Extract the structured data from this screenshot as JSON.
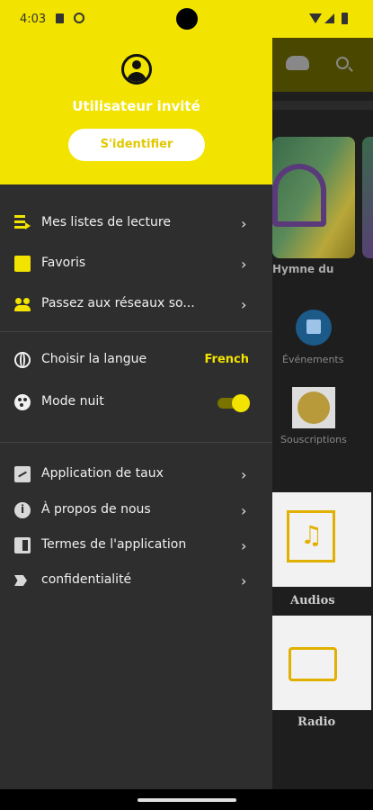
{
  "status_bar": {
    "time": "4:03",
    "icons": [
      "sim-card-icon",
      "download-icon",
      "wifi-icon",
      "signal-icon",
      "battery-icon"
    ]
  },
  "drawer": {
    "user_name": "Utilisateur invité",
    "login_label": "S'identifier",
    "section1": [
      {
        "icon": "playlist-icon",
        "label": "Mes listes de lecture"
      },
      {
        "icon": "favorites-icon",
        "label": "Favoris"
      },
      {
        "icon": "people-icon",
        "label": "Passez aux réseaux so..."
      }
    ],
    "language": {
      "icon": "globe-icon",
      "label": "Choisir la langue",
      "value": "French"
    },
    "night_mode": {
      "icon": "palette-icon",
      "label": "Mode nuit",
      "enabled": true
    },
    "section3": [
      {
        "icon": "rate-icon",
        "label": "Application de taux"
      },
      {
        "icon": "info-icon",
        "label": "À propos de nous"
      },
      {
        "icon": "terms-icon",
        "label": "Termes de l'application"
      },
      {
        "icon": "privacy-icon",
        "label": "confidentialité"
      }
    ]
  },
  "background_app": {
    "card_title": "Hymne du",
    "events_label": "Événements",
    "subscriptions_label": "Souscriptions",
    "audios_label": "Audios",
    "radio_label": "Radio"
  },
  "colors": {
    "accent": "#f2e300",
    "drawer_bg": "#2e2e2e",
    "text": "#f0f0f0"
  }
}
